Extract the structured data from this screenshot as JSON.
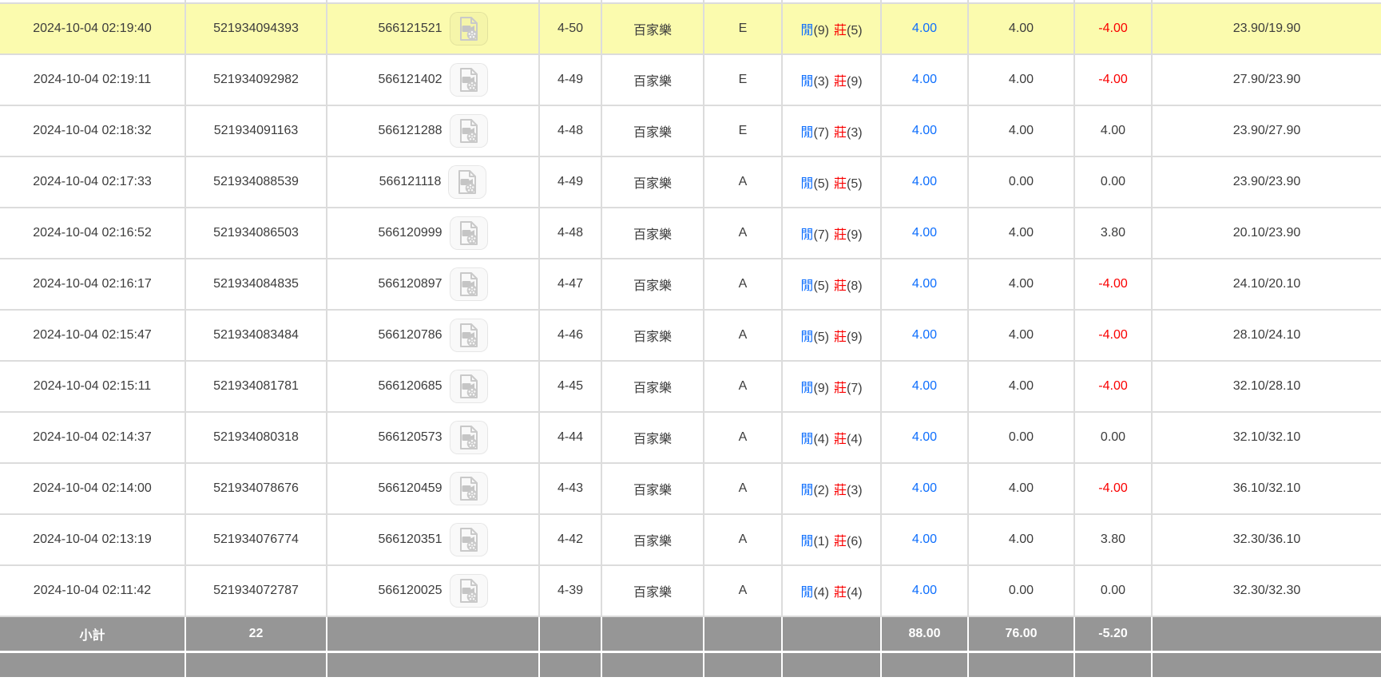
{
  "colors": {
    "highlight_row": "#fbfbae",
    "grid_border": "#dcdcdc",
    "subtotal_bg": "#969696",
    "text": "#3c3c3c",
    "player_blue": "#0d6efd",
    "banker_red": "#fa0000"
  },
  "table": {
    "result_labels": {
      "player": "閒",
      "banker": "莊"
    },
    "rows": [
      {
        "time": "2024-10-04 02:19:40",
        "bet_id": "521934094393",
        "round_id": "566121521",
        "shoe_round": "4-50",
        "game": "百家樂",
        "table_letter": "E",
        "player_score": 9,
        "banker_score": 5,
        "bet": "4.00",
        "valid": "4.00",
        "win_loss": "-4.00",
        "balance": "23.90/19.90",
        "highlighted": true
      },
      {
        "time": "2024-10-04 02:19:11",
        "bet_id": "521934092982",
        "round_id": "566121402",
        "shoe_round": "4-49",
        "game": "百家樂",
        "table_letter": "E",
        "player_score": 3,
        "banker_score": 9,
        "bet": "4.00",
        "valid": "4.00",
        "win_loss": "-4.00",
        "balance": "27.90/23.90",
        "highlighted": false
      },
      {
        "time": "2024-10-04 02:18:32",
        "bet_id": "521934091163",
        "round_id": "566121288",
        "shoe_round": "4-48",
        "game": "百家樂",
        "table_letter": "E",
        "player_score": 7,
        "banker_score": 3,
        "bet": "4.00",
        "valid": "4.00",
        "win_loss": "4.00",
        "balance": "23.90/27.90",
        "highlighted": false
      },
      {
        "time": "2024-10-04 02:17:33",
        "bet_id": "521934088539",
        "round_id": "566121118",
        "shoe_round": "4-49",
        "game": "百家樂",
        "table_letter": "A",
        "player_score": 5,
        "banker_score": 5,
        "bet": "4.00",
        "valid": "0.00",
        "win_loss": "0.00",
        "balance": "23.90/23.90",
        "highlighted": false
      },
      {
        "time": "2024-10-04 02:16:52",
        "bet_id": "521934086503",
        "round_id": "566120999",
        "shoe_round": "4-48",
        "game": "百家樂",
        "table_letter": "A",
        "player_score": 7,
        "banker_score": 9,
        "bet": "4.00",
        "valid": "4.00",
        "win_loss": "3.80",
        "balance": "20.10/23.90",
        "highlighted": false
      },
      {
        "time": "2024-10-04 02:16:17",
        "bet_id": "521934084835",
        "round_id": "566120897",
        "shoe_round": "4-47",
        "game": "百家樂",
        "table_letter": "A",
        "player_score": 5,
        "banker_score": 8,
        "bet": "4.00",
        "valid": "4.00",
        "win_loss": "-4.00",
        "balance": "24.10/20.10",
        "highlighted": false
      },
      {
        "time": "2024-10-04 02:15:47",
        "bet_id": "521934083484",
        "round_id": "566120786",
        "shoe_round": "4-46",
        "game": "百家樂",
        "table_letter": "A",
        "player_score": 5,
        "banker_score": 9,
        "bet": "4.00",
        "valid": "4.00",
        "win_loss": "-4.00",
        "balance": "28.10/24.10",
        "highlighted": false
      },
      {
        "time": "2024-10-04 02:15:11",
        "bet_id": "521934081781",
        "round_id": "566120685",
        "shoe_round": "4-45",
        "game": "百家樂",
        "table_letter": "A",
        "player_score": 9,
        "banker_score": 7,
        "bet": "4.00",
        "valid": "4.00",
        "win_loss": "-4.00",
        "balance": "32.10/28.10",
        "highlighted": false
      },
      {
        "time": "2024-10-04 02:14:37",
        "bet_id": "521934080318",
        "round_id": "566120573",
        "shoe_round": "4-44",
        "game": "百家樂",
        "table_letter": "A",
        "player_score": 4,
        "banker_score": 4,
        "bet": "4.00",
        "valid": "0.00",
        "win_loss": "0.00",
        "balance": "32.10/32.10",
        "highlighted": false
      },
      {
        "time": "2024-10-04 02:14:00",
        "bet_id": "521934078676",
        "round_id": "566120459",
        "shoe_round": "4-43",
        "game": "百家樂",
        "table_letter": "A",
        "player_score": 2,
        "banker_score": 3,
        "bet": "4.00",
        "valid": "4.00",
        "win_loss": "-4.00",
        "balance": "36.10/32.10",
        "highlighted": false
      },
      {
        "time": "2024-10-04 02:13:19",
        "bet_id": "521934076774",
        "round_id": "566120351",
        "shoe_round": "4-42",
        "game": "百家樂",
        "table_letter": "A",
        "player_score": 1,
        "banker_score": 6,
        "bet": "4.00",
        "valid": "4.00",
        "win_loss": "3.80",
        "balance": "32.30/36.10",
        "highlighted": false
      },
      {
        "time": "2024-10-04 02:11:42",
        "bet_id": "521934072787",
        "round_id": "566120025",
        "shoe_round": "4-39",
        "game": "百家樂",
        "table_letter": "A",
        "player_score": 4,
        "banker_score": 4,
        "bet": "4.00",
        "valid": "0.00",
        "win_loss": "0.00",
        "balance": "32.30/32.30",
        "highlighted": false
      }
    ],
    "subtotal": {
      "label": "小計",
      "count": "22",
      "bet_total": "88.00",
      "valid_total": "76.00",
      "win_loss_total": "-5.20"
    }
  }
}
